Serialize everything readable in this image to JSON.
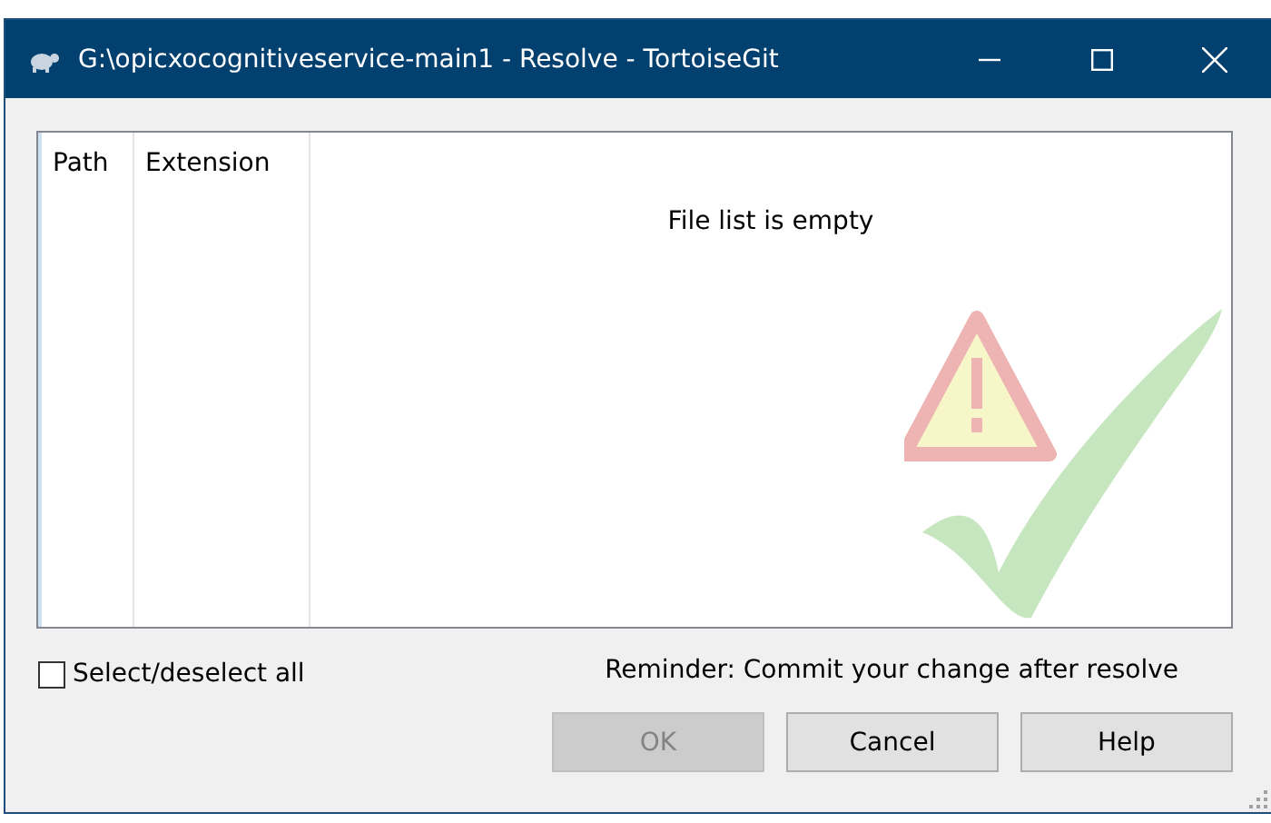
{
  "window": {
    "title": "G:\\opicxocognitiveservice-main1 - Resolve - TortoiseGit"
  },
  "file_list": {
    "columns": [
      "Path",
      "Extension"
    ],
    "empty_message": "File list is empty"
  },
  "select_all": {
    "label": "Select/deselect all",
    "checked": false
  },
  "reminder": "Reminder: Commit your change after resolve",
  "buttons": [
    {
      "label": "OK",
      "disabled": true
    },
    {
      "label": "Cancel",
      "disabled": false
    },
    {
      "label": "Help",
      "disabled": false
    }
  ]
}
